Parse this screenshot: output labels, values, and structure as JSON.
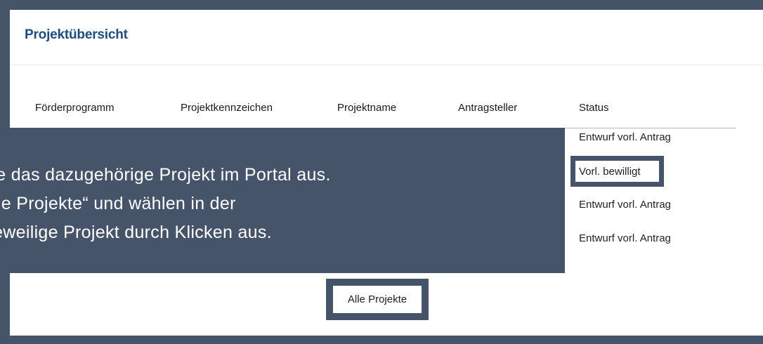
{
  "card": {
    "title": "Projektübersicht"
  },
  "table": {
    "columns": [
      "Förderprogramm",
      "Projektkennzeichen",
      "Projektname",
      "Antragsteller",
      "Status"
    ],
    "status_values": [
      "Entwurf vorl. Antrag",
      "Vorl. bewilligt",
      "Entwurf vorl. Antrag",
      "Entwurf vorl. Antrag"
    ]
  },
  "button": {
    "label": "Alle Projekte"
  },
  "tooltip": {
    "lines": [
      "n Sie das dazugehörige Projekt im Portal aus.",
      "f „Alle Projekte“ und wählen in der",
      "as jeweilige Projekt durch Klicken aus."
    ]
  },
  "colors": {
    "overlay": "#46546a",
    "title": "#1f4c7f",
    "card_bg": "#ffffff"
  }
}
